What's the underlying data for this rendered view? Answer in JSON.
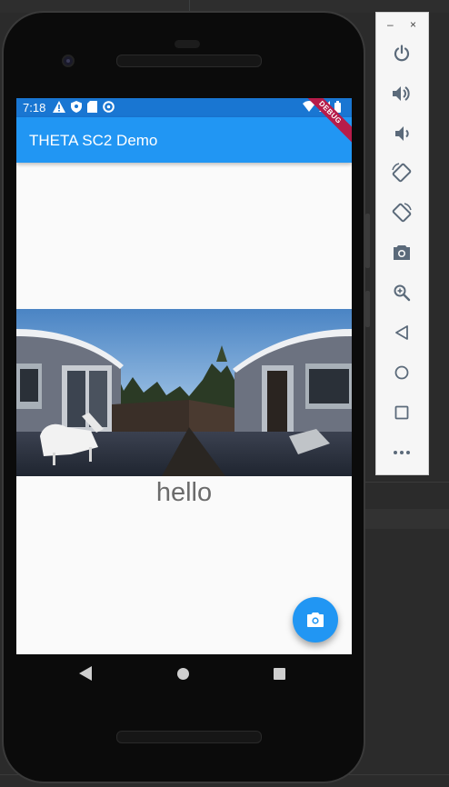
{
  "status_bar": {
    "time": "7:18"
  },
  "app_bar": {
    "title": "THETA SC2 Demo",
    "debug_label": "DEBUG"
  },
  "content": {
    "text": "hello"
  },
  "fab": {
    "icon": "camera-icon"
  },
  "emulator_toolbar": {
    "minimize": "–",
    "close": "×",
    "buttons": [
      "power-icon",
      "volume-up-icon",
      "volume-down-icon",
      "rotate-left-icon",
      "rotate-right-icon",
      "screenshot-camera-icon",
      "zoom-icon",
      "back-icon",
      "home-icon",
      "overview-icon",
      "more-icon"
    ]
  },
  "colors": {
    "app_bar": "#2196f3",
    "status_bar": "#1976d2",
    "fab": "#2196f3",
    "emulator_icon": "#5b6a7a"
  }
}
